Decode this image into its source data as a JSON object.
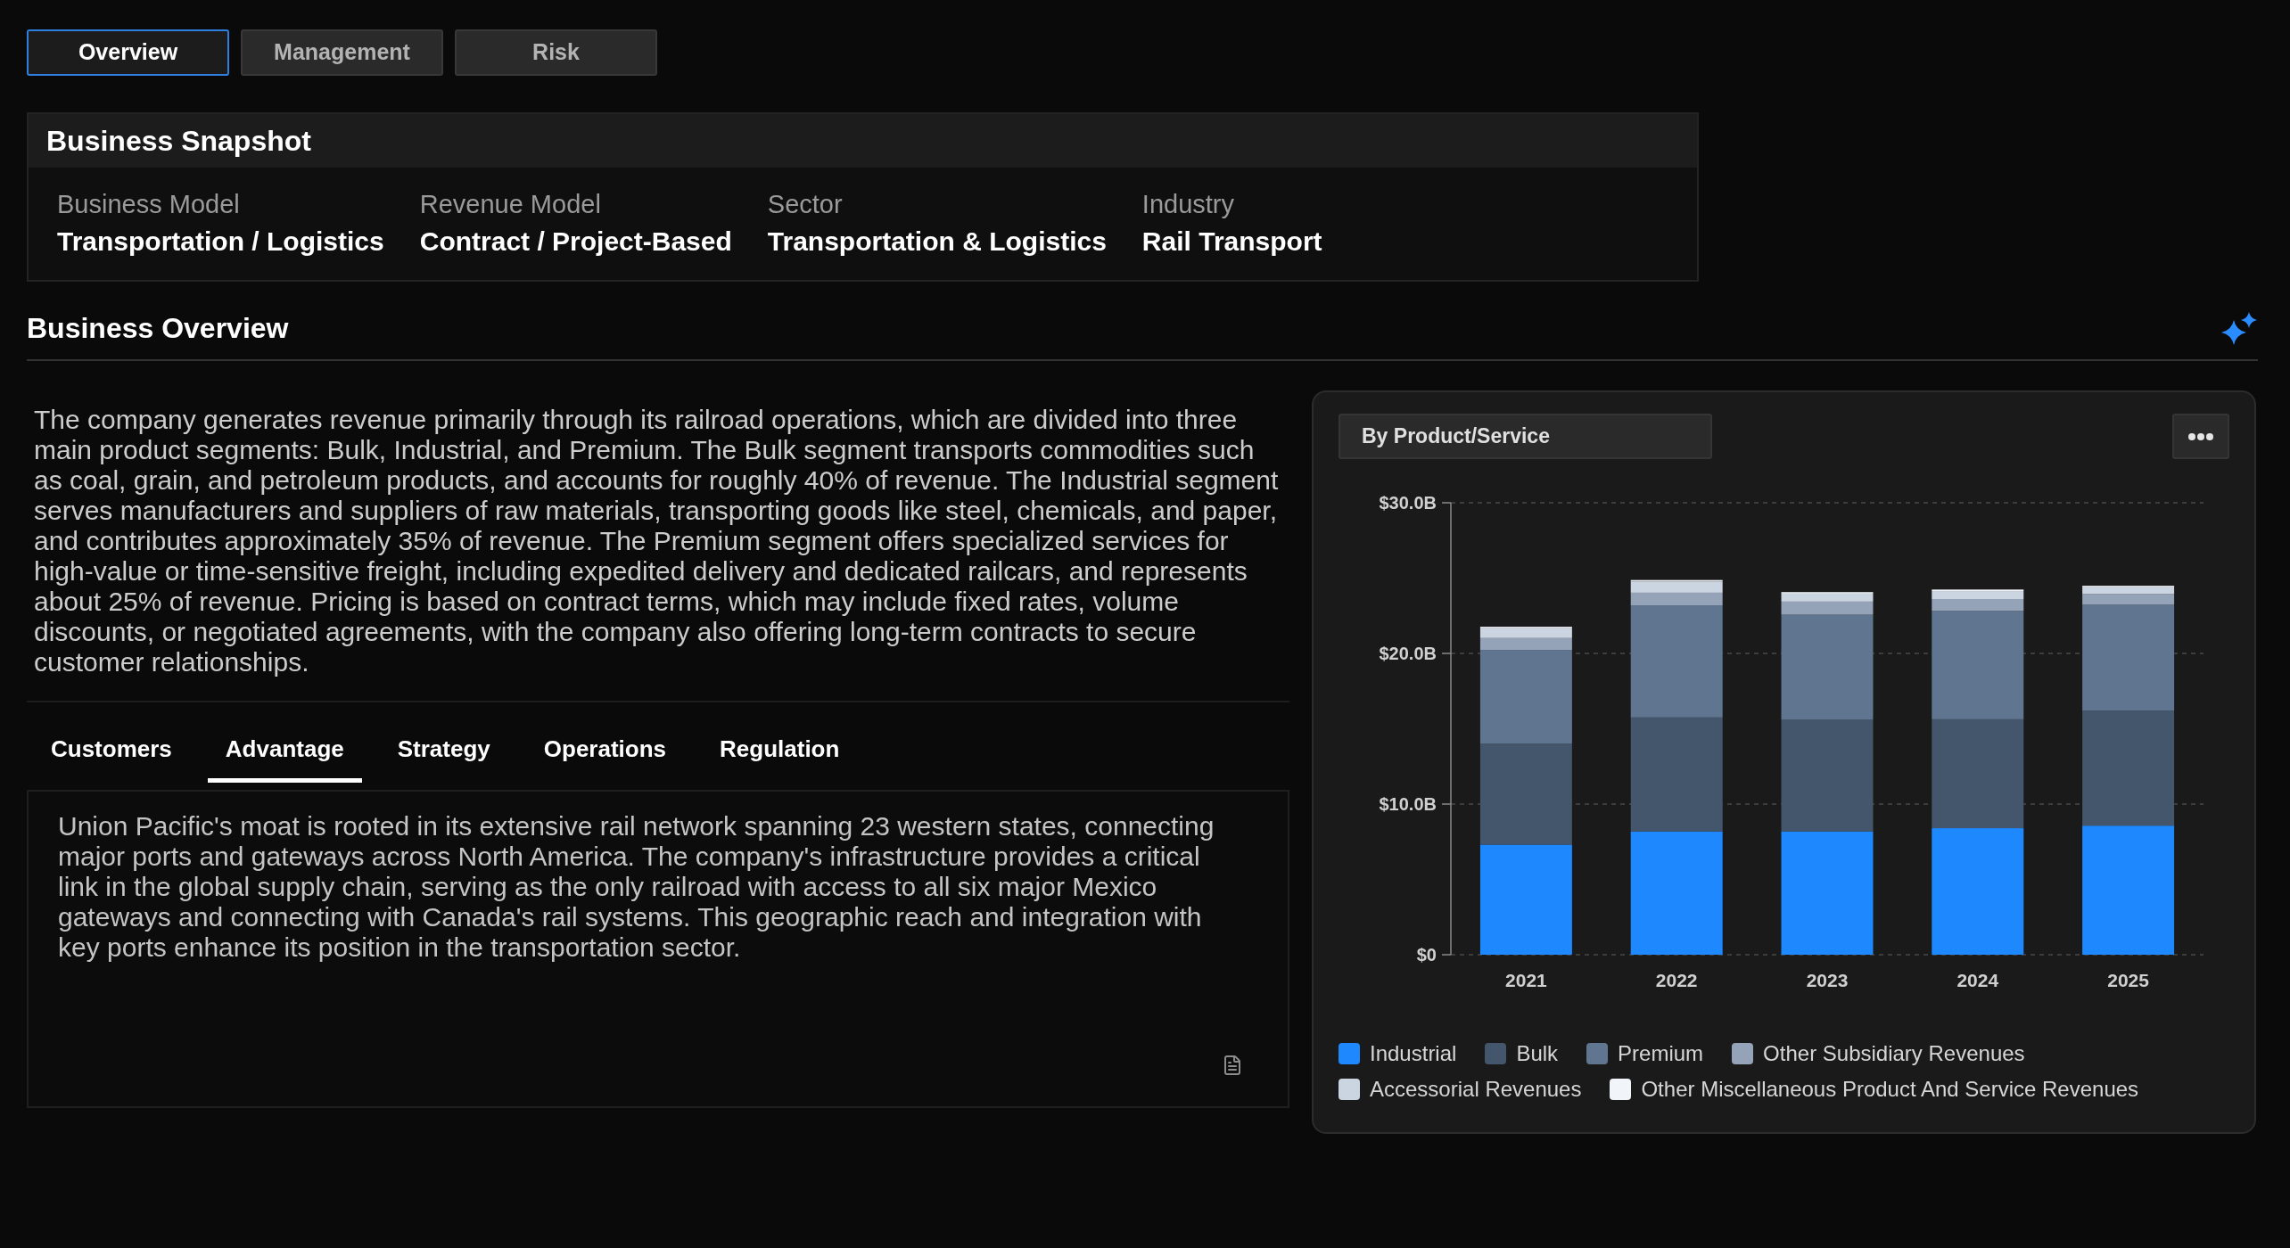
{
  "top_tabs": [
    {
      "label": "Overview",
      "selected": true
    },
    {
      "label": "Management",
      "selected": false
    },
    {
      "label": "Risk",
      "selected": false
    }
  ],
  "business_snapshot": {
    "title": "Business Snapshot",
    "fields": [
      {
        "label": "Business Model",
        "value": "Transportation / Logistics"
      },
      {
        "label": "Revenue Model",
        "value": "Contract / Project-Based"
      },
      {
        "label": "Sector",
        "value": "Transportation & Logistics"
      },
      {
        "label": "Industry",
        "value": "Rail Transport"
      }
    ]
  },
  "business_overview": {
    "title": "Business Overview",
    "description": "The company generates revenue primarily through its railroad operations, which are divided into three main product segments: Bulk, Industrial, and Premium. The Bulk segment transports commodities such as coal, grain, and petroleum products, and accounts for roughly 40% of revenue. The Industrial segment serves manufacturers and suppliers of raw materials, transporting goods like steel, chemicals, and paper, and contributes approximately 35% of revenue. The Premium segment offers specialized services for high-value or time-sensitive freight, including expedited delivery and dedicated railcars, and represents about 25% of revenue. Pricing is based on contract terms, which may include fixed rates, volume discounts, or negotiated agreements, with the company also offering long-term contracts to secure customer relationships.",
    "tabs": [
      {
        "label": "Customers",
        "selected": false
      },
      {
        "label": "Advantage",
        "selected": true
      },
      {
        "label": "Strategy",
        "selected": false
      },
      {
        "label": "Operations",
        "selected": false
      },
      {
        "label": "Regulation",
        "selected": false
      }
    ],
    "tab_content": "Union Pacific's moat is rooted in its extensive rail network spanning 23 western states, connecting major ports and gateways across North America. The company's infrastructure provides a critical link in the global supply chain, serving as the only railroad with access to all six major Mexico gateways and connecting with Canada's rail systems. This geographic reach and integration with key ports enhance its position in the transportation sector."
  },
  "revenue_chart": {
    "dropdown": "By Product/Service",
    "chart_data": {
      "type": "bar",
      "stacked": true,
      "categories": [
        "2021",
        "2022",
        "2023",
        "2024",
        "2025"
      ],
      "ylim": [
        0,
        30
      ],
      "yticks": [
        {
          "value": 0,
          "label": "$0"
        },
        {
          "value": 10,
          "label": "$10.0B"
        },
        {
          "value": 20,
          "label": "$20.0B"
        },
        {
          "value": 30,
          "label": "$30.0B"
        }
      ],
      "series": [
        {
          "name": "Industrial",
          "color": "#1e88ff",
          "values": [
            7.31,
            8.19,
            8.19,
            8.4,
            8.57
          ]
        },
        {
          "name": "Bulk",
          "color": "#44566c",
          "values": [
            6.69,
            7.56,
            7.4,
            7.23,
            7.64
          ]
        },
        {
          "name": "Premium",
          "color": "#5f7590",
          "values": [
            6.23,
            7.44,
            6.98,
            7.19,
            7.02
          ]
        },
        {
          "name": "Other Subsidiary Revenues",
          "color": "#94a3b8",
          "values": [
            0.79,
            0.84,
            0.87,
            0.79,
            0.71
          ]
        },
        {
          "name": "Accessorial Revenues",
          "color": "#cbd5e1",
          "values": [
            0.65,
            0.74,
            0.53,
            0.53,
            0.45
          ]
        },
        {
          "name": "Other Miscellaneous Product And Service Revenues",
          "color": "#f1f5f9",
          "values": [
            0.1,
            0.1,
            0.1,
            0.1,
            0.1
          ]
        }
      ]
    }
  }
}
